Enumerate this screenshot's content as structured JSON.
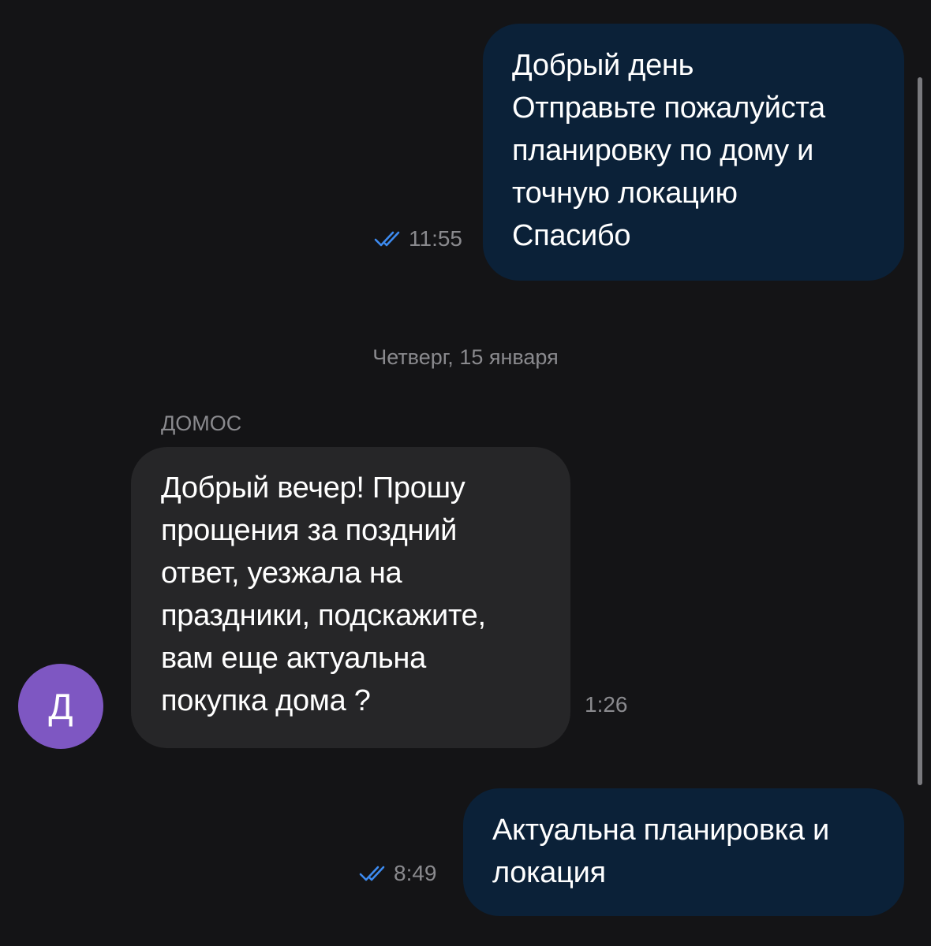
{
  "messages": [
    {
      "direction": "outgoing",
      "lines": [
        "Добрый день",
        "Отправьте пожалуйста",
        "планировку по дому и",
        "точную локацию",
        "Спасибо"
      ],
      "time": "11:55",
      "status": "read-double-check-icon"
    },
    {
      "direction": "incoming",
      "sender": "ДОМОС",
      "avatar_letter": "Д",
      "lines": [
        "Добрый вечер! Прошу",
        "прощения за поздний",
        "ответ, уезжала на",
        "праздники, подскажите,",
        "вам еще актуальна",
        "покупка дома ?"
      ],
      "time": "1:26"
    },
    {
      "direction": "outgoing",
      "lines": [
        "Актуальна планировка и",
        "локация"
      ],
      "time": "8:49",
      "status": "read-double-check-icon"
    }
  ],
  "date_separator": "Четверг, 15 января",
  "colors": {
    "background": "#141416",
    "outgoing_bubble": "#0b2138",
    "incoming_bubble": "#262628",
    "meta_text": "#8a8a8e",
    "check_icon": "#3d8bf0",
    "avatar": "#7e57c2"
  }
}
